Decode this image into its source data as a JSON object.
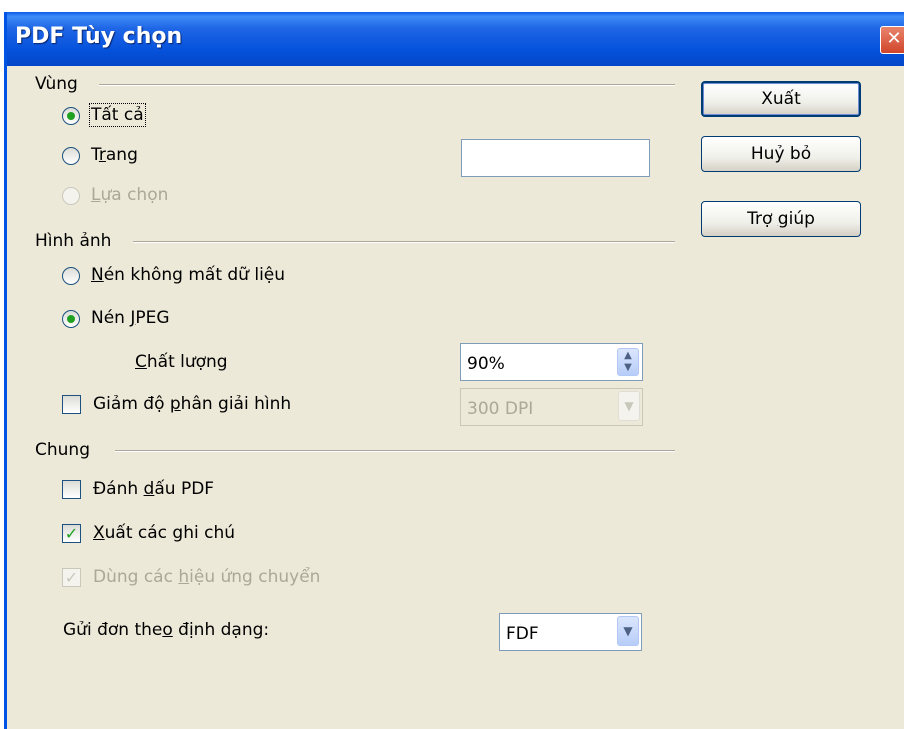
{
  "window": {
    "title": "PDF Tùy chọn",
    "close_glyph": "✕"
  },
  "groups": {
    "range": {
      "label": "Vùng"
    },
    "images": {
      "label": "Hình ảnh"
    },
    "general": {
      "label": "Chung"
    }
  },
  "range": {
    "all": {
      "label": "Tất cả",
      "checked": true
    },
    "pages": {
      "pre": "T",
      "underline": "r",
      "post": "ang",
      "value": ""
    },
    "selection": {
      "pre": "",
      "underline": "L",
      "post": "ựa chọn",
      "disabled": true
    }
  },
  "images": {
    "lossless": {
      "pre": "",
      "underline": "N",
      "post": "én không mất dữ liệu",
      "checked": false
    },
    "jpeg": {
      "pre": "Nén ",
      "underline": "J",
      "post": "PEG",
      "checked": true
    },
    "quality": {
      "pre": "",
      "underline": "C",
      "post": "hất lượng",
      "value": "90%"
    },
    "reduce": {
      "pre": "Giảm độ ",
      "underline": "p",
      "post": "hân giải hình",
      "checked": false,
      "value": "300 DPI"
    }
  },
  "general": {
    "bookmarks": {
      "pre": "Đánh ",
      "underline": "d",
      "post": "ấu PDF",
      "checked": false
    },
    "notes": {
      "pre": "",
      "underline": "X",
      "post": "uất các ghi chú",
      "checked": true
    },
    "transitions": {
      "pre": "Dùng các ",
      "underline": "h",
      "post": "iệu ứng chuyển",
      "checked": true,
      "disabled": true
    },
    "submit_format": {
      "pre": "Gửi đơn the",
      "underline": "o",
      "post": " định dạng:",
      "value": "FDF"
    }
  },
  "buttons": {
    "export": "Xuất",
    "cancel": "Huỷ bỏ",
    "help_pre": "Trợ ",
    "help_underline": "g",
    "help_post": "iúp"
  },
  "icons": {
    "radio": "radio-icon",
    "checkbox": "checkbox-icon",
    "spin": "spin-arrows-icon",
    "dropdown": "chevron-down-icon",
    "close": "close-icon"
  },
  "colors": {
    "titlebar": "#0552dc",
    "dialog_bg": "#ece9d8",
    "radio_dot": "#21a121",
    "disabled_text": "#aca899"
  }
}
